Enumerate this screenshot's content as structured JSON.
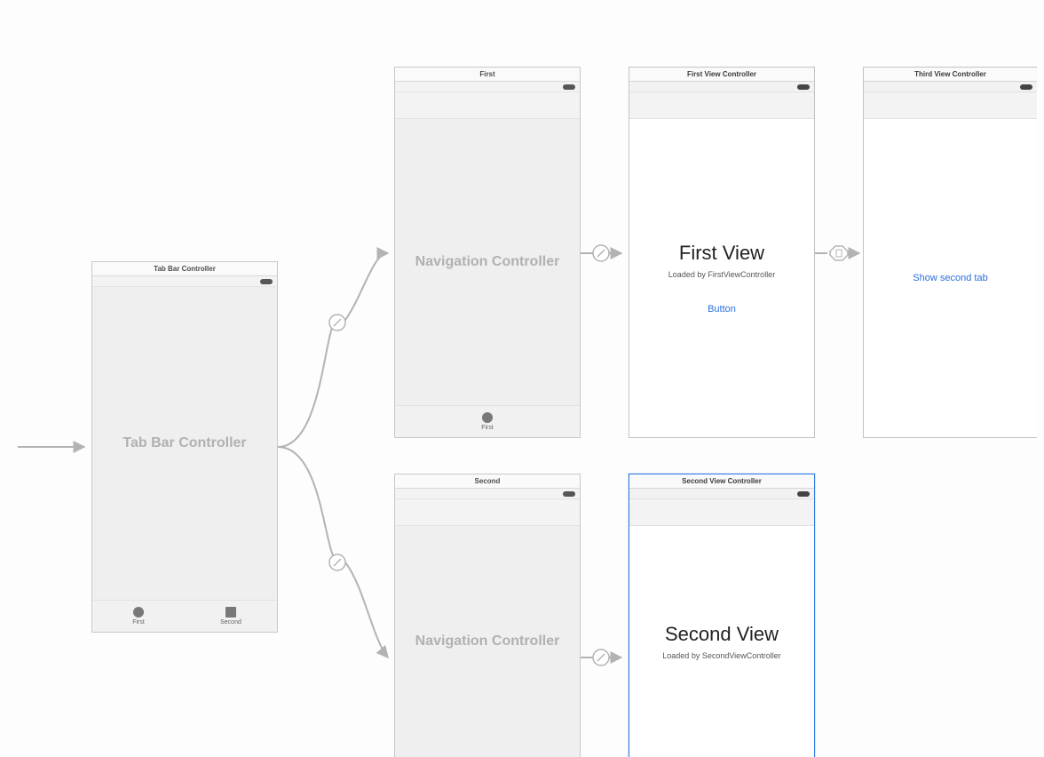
{
  "tabbar_scene": {
    "title": "Tab Bar Controller",
    "body_label": "Tab Bar Controller",
    "tabs": [
      {
        "label": "First"
      },
      {
        "label": "Second"
      }
    ]
  },
  "nav1_scene": {
    "title": "First",
    "body_label": "Navigation Controller",
    "tabs": [
      {
        "label": "First"
      }
    ]
  },
  "nav2_scene": {
    "title": "Second",
    "body_label": "Navigation Controller"
  },
  "first_vc": {
    "title": "First View Controller",
    "heading": "First View",
    "subtitle": "Loaded by FirstViewController",
    "button": "Button"
  },
  "second_vc": {
    "title": "Second View Controller",
    "heading": "Second View",
    "subtitle": "Loaded by SecondViewController"
  },
  "third_vc": {
    "title": "Third View Controller",
    "button": "Show second tab"
  }
}
